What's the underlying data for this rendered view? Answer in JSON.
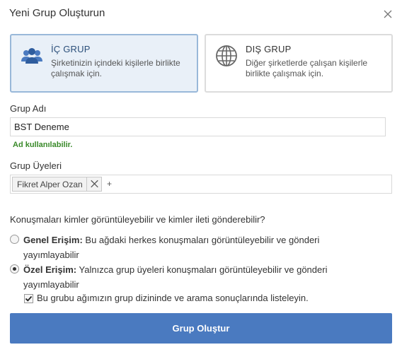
{
  "dialog": {
    "title": "Yeni Grup Oluşturun"
  },
  "group_types": {
    "internal": {
      "title": "İÇ GRUP",
      "description": "Şirketinizin içindeki kişilerle birlikte çalışmak için.",
      "icon": "people-icon",
      "selected": true
    },
    "external": {
      "title": "DIŞ GRUP",
      "description": "Diğer şirketlerde çalışan kişilerle birlikte çalışmak için.",
      "icon": "globe-icon",
      "selected": false
    }
  },
  "group_name": {
    "label": "Grup Adı",
    "value": "BST Deneme",
    "status": "Ad kullanılabilir."
  },
  "members": {
    "label": "Grup Üyeleri",
    "tags": [
      "Fikret Alper Ozan"
    ],
    "add_symbol": "+"
  },
  "access": {
    "question": "Konuşmaları kimler görüntüleyebilir ve kimler ileti gönderebilir?",
    "public": {
      "label": "Genel Erişim:",
      "text": " Bu ağdaki herkes konuşmaları görüntüleyebilir ve gönderi yayımlayabilir",
      "selected": false
    },
    "private": {
      "label": "Özel Erişim:",
      "text": " Yalnızca grup üyeleri konuşmaları görüntüleyebilir ve gönderi yayımlayabilir",
      "selected": true
    },
    "directory_checkbox": {
      "label": "Bu grubu ağımızın grup dizininde ve arama sonuçlarında listeleyin.",
      "checked": true
    }
  },
  "submit_label": "Grup Oluştur",
  "colors": {
    "primary_button": "#4a7ac0",
    "selected_card_bg": "#e9f0f8",
    "selected_card_border": "#99b8d9",
    "success_text": "#3a8a2a"
  }
}
